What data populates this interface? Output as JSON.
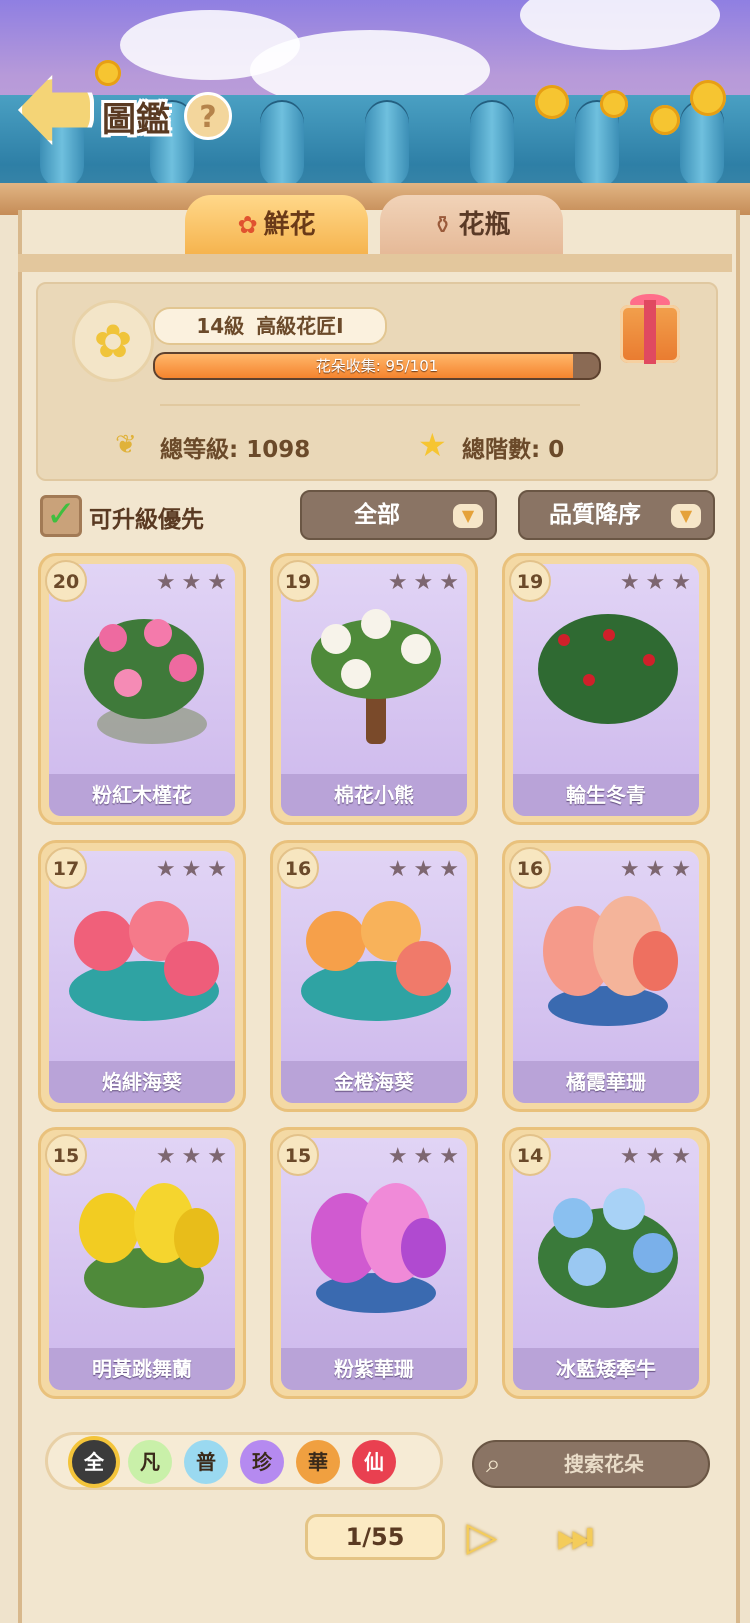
{
  "header": {
    "title": "圖鑑",
    "help": "?"
  },
  "tabs": [
    {
      "label": "鮮花",
      "icon": "rose-icon"
    },
    {
      "label": "花瓶",
      "icon": "vase-icon"
    }
  ],
  "profile": {
    "level": "14級",
    "rank": "高級花匠Ⅰ",
    "progress_label": "花朵收集: 95/101",
    "progress_fraction": 0.941,
    "total_level": "總等級: 1098",
    "total_stars": "總階數: 0"
  },
  "filters": {
    "upgrade_first_label": "可升級優先",
    "upgrade_first_checked": true,
    "category": "全部",
    "sort": "品質降序"
  },
  "cards": [
    {
      "level": "20",
      "name": "粉紅木槿花",
      "stars": "★★★"
    },
    {
      "level": "19",
      "name": "棉花小熊",
      "stars": "★★★"
    },
    {
      "level": "19",
      "name": "輪生冬青",
      "stars": "★★★"
    },
    {
      "level": "17",
      "name": "焰緋海葵",
      "stars": "★★★"
    },
    {
      "level": "16",
      "name": "金橙海葵",
      "stars": "★★★"
    },
    {
      "level": "16",
      "name": "橘霞華珊",
      "stars": "★★★"
    },
    {
      "level": "15",
      "name": "明黃跳舞蘭",
      "stars": "★★★"
    },
    {
      "level": "15",
      "name": "粉紫華珊",
      "stars": "★★★"
    },
    {
      "level": "14",
      "name": "冰藍矮牽牛",
      "stars": "★★★"
    }
  ],
  "rarity": [
    "全",
    "凡",
    "普",
    "珍",
    "華",
    "仙"
  ],
  "search": {
    "placeholder": "搜索花朵"
  },
  "pagination": {
    "page": "1/55"
  },
  "colors": {
    "card_bg": "#d9c8f0",
    "accent": "#f5842e",
    "rarity_colors": [
      "#3a3a3a",
      "#c9f0a9",
      "#9ad9f0",
      "#b58af0",
      "#f0a040",
      "#e94050"
    ]
  }
}
